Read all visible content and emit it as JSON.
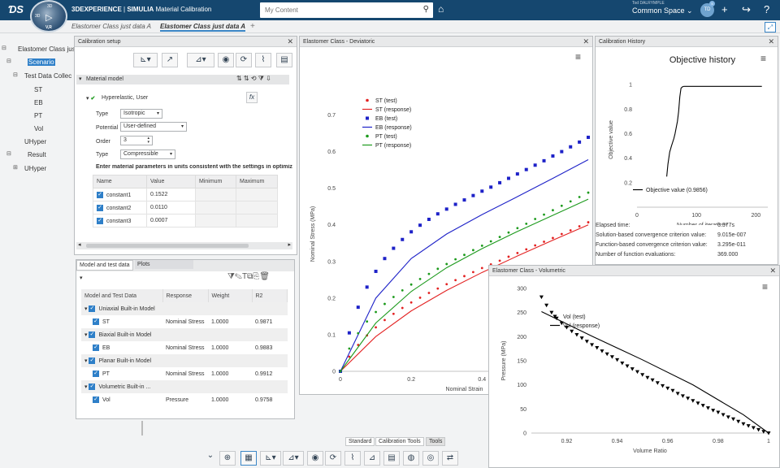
{
  "app": {
    "brand_3d": "3DEXPERIENCE",
    "brand_sep": " | ",
    "brand_app": "SIMULIA",
    "brand_mod": "Material Calibration",
    "compass_vr": "V,R",
    "compass_3d": "3D",
    "compass_top": "3D"
  },
  "search": {
    "placeholder": "My Content"
  },
  "user": {
    "name": "Tod DALRYMPLE",
    "space": "Common Space",
    "initials": "TD",
    "badge": "5"
  },
  "tabs": [
    {
      "label": "Elastomer Class just data A"
    },
    {
      "label": "Elastomer Class just data A"
    }
  ],
  "tree": {
    "root": "Elastomer Class just",
    "scenario": "Scenario",
    "test_data": "Test Data Collec",
    "st": "ST",
    "eb": "EB",
    "pt": "PT",
    "vol": "Vol",
    "uhyper1": "UHyper",
    "result": "Result",
    "uhyper2": "UHyper"
  },
  "calib": {
    "title": "Calibration setup",
    "material_model": "Material model",
    "model_name": "Hyperelastic, User",
    "fx": "fx",
    "type_label": "Type",
    "type_value": "Isotropic",
    "potential_label": "Potential",
    "potential_value": "User-defined",
    "order_label": "Order",
    "order_value": "3",
    "type2_label": "Type",
    "type2_value": "Compressible",
    "instructions": "Enter material parameters in units consistent with the settings in optimiz",
    "param_headers": [
      "Name",
      "Value",
      "Minimum",
      "Maximum"
    ],
    "params": [
      {
        "name": "constant1",
        "value": "0.1522"
      },
      {
        "name": "constant2",
        "value": "0.0110"
      },
      {
        "name": "constant3",
        "value": "0.0007"
      }
    ]
  },
  "model_panel": {
    "tab1": "Model and test data",
    "tab2": "Plots",
    "headers": [
      "Model and Test Data",
      "Response",
      "Weight",
      "R2"
    ],
    "rows": [
      {
        "group": "Uniaxial Built-in Model",
        "name": "ST",
        "response": "Nominal Stress",
        "weight": "1.0000",
        "r2": "0.9871"
      },
      {
        "group": "Biaxial Built-in Model",
        "name": "EB",
        "response": "Nominal Stress",
        "weight": "1.0000",
        "r2": "0.9883"
      },
      {
        "group": "Planar Built-in Model",
        "name": "PT",
        "response": "Nominal Stress",
        "weight": "1.0000",
        "r2": "0.9912"
      },
      {
        "group": "Volumetric Built-in ...",
        "name": "Vol",
        "response": "Pressure",
        "weight": "1.0000",
        "r2": "0.9758"
      }
    ]
  },
  "dev_panel": {
    "title": "Elastomer Class - Deviatoric"
  },
  "hist_panel": {
    "title": "Calibration History"
  },
  "vol_panel": {
    "title": "Elastomer Class - Volumetric"
  },
  "stats": [
    {
      "label": "Elapsed time:",
      "value": "6.377s"
    },
    {
      "label": "Solution-based convergence criterion value:",
      "value": "9.015e-007"
    },
    {
      "label": "Function-based convergence criterion value:",
      "value": "3.295e-011"
    },
    {
      "label": "Number of function evaluations:",
      "value": "369.000"
    }
  ],
  "bottom_tabs": [
    "Standard",
    "Calibration Tools",
    "Tools"
  ],
  "colors": {
    "red": "#e32222",
    "blue": "#1e22c8",
    "green": "#1c9a1c",
    "accent": "#2e7fc8",
    "topbar": "#15476f"
  },
  "chart_data": [
    {
      "type": "scatter",
      "xlabel": "Nominal Strain",
      "ylabel": "Nominal Stress (MPa)",
      "xlim": [
        0,
        0.7
      ],
      "ylim": [
        0,
        0.75
      ],
      "xticks": [
        "0",
        "0.2",
        "0.4"
      ],
      "yticks": [
        "0",
        "0.1",
        "0.2",
        "0.3",
        "0.4",
        "0.5",
        "0.6",
        "0.7"
      ],
      "series": [
        {
          "name": "ST (test)",
          "kind": "dots",
          "color": "#e32222",
          "x": [
            0,
            0.025,
            0.05,
            0.075,
            0.1,
            0.125,
            0.15,
            0.175,
            0.2,
            0.225,
            0.25,
            0.275,
            0.3,
            0.325,
            0.35,
            0.375,
            0.4,
            0.425,
            0.45,
            0.475,
            0.5,
            0.525,
            0.55,
            0.575,
            0.6,
            0.625,
            0.65,
            0.675,
            0.7,
            0.725,
            0.75,
            0.775,
            0.8,
            0.825,
            0.85,
            0.875,
            0.9
          ],
          "y": [
            0,
            0.04,
            0.072,
            0.098,
            0.12,
            0.14,
            0.157,
            0.173,
            0.188,
            0.201,
            0.214,
            0.226,
            0.238,
            0.249,
            0.26,
            0.271,
            0.282,
            0.292,
            0.302,
            0.313,
            0.323,
            0.333,
            0.344,
            0.354,
            0.364,
            0.375,
            0.385,
            0.396,
            0.407,
            0.418,
            0.43,
            0.441,
            0.453,
            0.465,
            0.477,
            0.49,
            0.502
          ]
        },
        {
          "name": "ST (response)",
          "kind": "line",
          "color": "#e32222",
          "x": [
            0,
            0.1,
            0.2,
            0.3,
            0.4,
            0.5,
            0.6,
            0.7,
            0.8,
            0.9
          ],
          "y": [
            0,
            0.095,
            0.165,
            0.221,
            0.27,
            0.315,
            0.358,
            0.4,
            0.443,
            0.49
          ]
        },
        {
          "name": "EB (test)",
          "kind": "squares",
          "color": "#1e22c8",
          "x": [
            0,
            0.025,
            0.05,
            0.075,
            0.1,
            0.125,
            0.15,
            0.175,
            0.2,
            0.225,
            0.25,
            0.275,
            0.3,
            0.325,
            0.35,
            0.375,
            0.4,
            0.425,
            0.45,
            0.475,
            0.5,
            0.525,
            0.55,
            0.575,
            0.6,
            0.625,
            0.65,
            0.675,
            0.7,
            0.725,
            0.75,
            0.775,
            0.8,
            0.825,
            0.85,
            0.875,
            0.9
          ],
          "y": [
            0,
            0.105,
            0.175,
            0.23,
            0.273,
            0.308,
            0.336,
            0.36,
            0.381,
            0.399,
            0.415,
            0.43,
            0.443,
            0.456,
            0.468,
            0.48,
            0.492,
            0.503,
            0.515,
            0.527,
            0.539,
            0.551,
            0.563,
            0.575,
            0.588,
            0.6,
            0.613,
            0.626,
            0.639,
            0.652,
            0.665,
            0.679,
            0.692,
            0.706,
            0.72,
            0.734,
            0.748
          ]
        },
        {
          "name": "EB (response)",
          "kind": "line",
          "color": "#1e22c8",
          "x": [
            0,
            0.1,
            0.2,
            0.3,
            0.4,
            0.5,
            0.6,
            0.7,
            0.8,
            0.9
          ],
          "y": [
            0,
            0.2,
            0.308,
            0.375,
            0.428,
            0.477,
            0.527,
            0.578,
            0.63,
            0.695
          ]
        },
        {
          "name": "PT (test)",
          "kind": "dots",
          "color": "#1c9a1c",
          "x": [
            0,
            0.025,
            0.05,
            0.075,
            0.1,
            0.125,
            0.15,
            0.175,
            0.2,
            0.225,
            0.25,
            0.275,
            0.3,
            0.325,
            0.35,
            0.375,
            0.4,
            0.425,
            0.45,
            0.475,
            0.5,
            0.525,
            0.55,
            0.575,
            0.6,
            0.625,
            0.65,
            0.675,
            0.7,
            0.725,
            0.75,
            0.775,
            0.8,
            0.825,
            0.85,
            0.875,
            0.9
          ],
          "y": [
            0,
            0.062,
            0.104,
            0.136,
            0.162,
            0.184,
            0.203,
            0.221,
            0.237,
            0.252,
            0.266,
            0.28,
            0.293,
            0.306,
            0.318,
            0.331,
            0.343,
            0.355,
            0.367,
            0.379,
            0.391,
            0.403,
            0.416,
            0.428,
            0.44,
            0.452,
            0.464,
            0.476,
            0.488,
            0.5,
            0.512,
            0.524,
            0.536,
            0.548,
            0.56,
            0.572,
            0.584
          ]
        },
        {
          "name": "PT (response)",
          "kind": "line",
          "color": "#1c9a1c",
          "x": [
            0,
            0.1,
            0.2,
            0.3,
            0.4,
            0.5,
            0.6,
            0.7,
            0.8,
            0.9
          ],
          "y": [
            0,
            0.132,
            0.218,
            0.283,
            0.335,
            0.382,
            0.426,
            0.47,
            0.514,
            0.54
          ]
        }
      ]
    },
    {
      "type": "line",
      "title": "Objective history",
      "xlabel": "Number of iterations",
      "ylabel": "Objective value",
      "xlim": [
        0,
        220
      ],
      "ylim": [
        0,
        1.1
      ],
      "xticks": [
        "0",
        "100",
        "200"
      ],
      "yticks": [
        "0.2",
        "0.4",
        "0.6",
        "0.8",
        "1"
      ],
      "series": [
        {
          "name": "Objective value (0.9856)",
          "color": "#000000",
          "x": [
            50,
            52,
            55,
            58,
            60,
            62,
            64,
            66,
            68,
            70,
            72,
            74,
            76,
            78,
            80,
            85,
            90,
            120,
            160,
            210
          ],
          "y": [
            0.25,
            0.35,
            0.45,
            0.5,
            0.53,
            0.56,
            0.6,
            0.65,
            0.7,
            0.78,
            0.9,
            0.97,
            0.98,
            0.985,
            0.9856,
            0.9856,
            0.9856,
            0.9856,
            0.9856,
            0.9856
          ]
        }
      ]
    },
    {
      "type": "scatter",
      "xlabel": "Volume Ratio",
      "ylabel": "Pressure (MPa)",
      "xlim": [
        0.906,
        1.0
      ],
      "ylim": [
        0,
        300
      ],
      "xticks": [
        "0.92",
        "0.94",
        "0.96",
        "0.98",
        "1"
      ],
      "yticks": [
        "0",
        "50",
        "100",
        "150",
        "200",
        "250",
        "300"
      ],
      "series": [
        {
          "name": "Vol (test)",
          "kind": "triangles",
          "color": "#000000",
          "x": [
            0.91,
            0.912,
            0.914,
            0.916,
            0.918,
            0.92,
            0.922,
            0.924,
            0.926,
            0.928,
            0.93,
            0.932,
            0.934,
            0.936,
            0.938,
            0.94,
            0.942,
            0.944,
            0.946,
            0.948,
            0.95,
            0.952,
            0.954,
            0.956,
            0.958,
            0.96,
            0.962,
            0.964,
            0.966,
            0.968,
            0.97,
            0.972,
            0.974,
            0.976,
            0.978,
            0.98,
            0.982,
            0.984,
            0.986,
            0.988,
            0.99,
            0.992,
            0.994,
            0.996,
            0.998,
            1.0
          ],
          "y": [
            282,
            265,
            250,
            238,
            228,
            219,
            211,
            204,
            197,
            190,
            183,
            177,
            170,
            164,
            158,
            152,
            145,
            139,
            133,
            127,
            121,
            115,
            110,
            104,
            98,
            93,
            88,
            82,
            77,
            72,
            67,
            62,
            57,
            52,
            47,
            43,
            38,
            33,
            29,
            24,
            19,
            15,
            11,
            7,
            3,
            0
          ]
        },
        {
          "name": "Vol (response)",
          "kind": "line",
          "color": "#000000",
          "x": [
            0.91,
            0.93,
            0.95,
            0.97,
            0.99,
            1.0
          ],
          "y": [
            252,
            201,
            152,
            100,
            38,
            0
          ]
        }
      ]
    }
  ]
}
